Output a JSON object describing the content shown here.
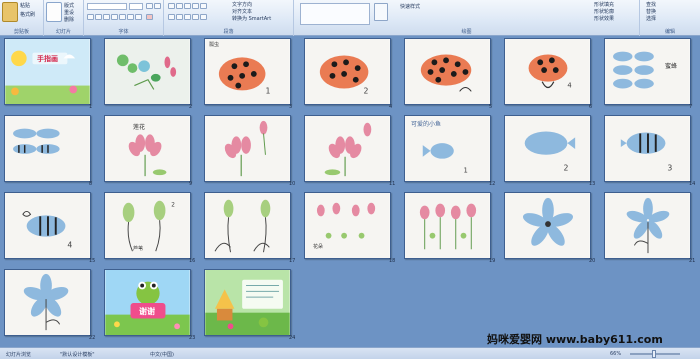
{
  "ribbon": {
    "groups": {
      "clipboard": "剪贴板",
      "slides": "幻灯片",
      "font": "字体",
      "paragraph": "段落",
      "drawing": "绘图",
      "editing": "编辑"
    },
    "buttons": {
      "paste": "粘贴",
      "format_painter": "格式刷",
      "new_slide": "新建\n幻灯片",
      "layout": "版式",
      "reset": "重设",
      "delete": "删除",
      "text_direction": "文字方向",
      "align_text": "对齐文本",
      "convert_smartart": "转换为 SmartArt",
      "quick_styles": "快速样式",
      "shape_fill": "形状填充",
      "shape_outline": "形状轮廓",
      "shape_effects": "形状效果",
      "find": "查找",
      "replace": "替换",
      "select": "选择"
    }
  },
  "slides": [
    {
      "num": "1",
      "title": "手指画"
    },
    {
      "num": "2",
      "title": ""
    },
    {
      "num": "3",
      "title": "瓢虫"
    },
    {
      "num": "4",
      "title": ""
    },
    {
      "num": "5",
      "title": ""
    },
    {
      "num": "6",
      "title": ""
    },
    {
      "num": "7",
      "title": "蜜蜂"
    },
    {
      "num": "8",
      "title": ""
    },
    {
      "num": "9",
      "title": "莲花"
    },
    {
      "num": "10",
      "title": ""
    },
    {
      "num": "11",
      "title": ""
    },
    {
      "num": "12",
      "title": "可爱的小鱼"
    },
    {
      "num": "13",
      "title": ""
    },
    {
      "num": "14",
      "title": ""
    },
    {
      "num": "15",
      "title": ""
    },
    {
      "num": "16",
      "title": "芦苇"
    },
    {
      "num": "17",
      "title": ""
    },
    {
      "num": "18",
      "title": "花朵"
    },
    {
      "num": "19",
      "title": ""
    },
    {
      "num": "20",
      "title": ""
    },
    {
      "num": "21",
      "title": ""
    },
    {
      "num": "22",
      "title": ""
    },
    {
      "num": "23",
      "title": "谢谢"
    },
    {
      "num": "24",
      "title": ""
    }
  ],
  "watermark": "妈咪爱婴网 www.baby611.com",
  "status": {
    "view": "幻灯片浏览",
    "theme": "\"默认设计模板\"",
    "language": "中文(中国)",
    "zoom": "66%"
  }
}
